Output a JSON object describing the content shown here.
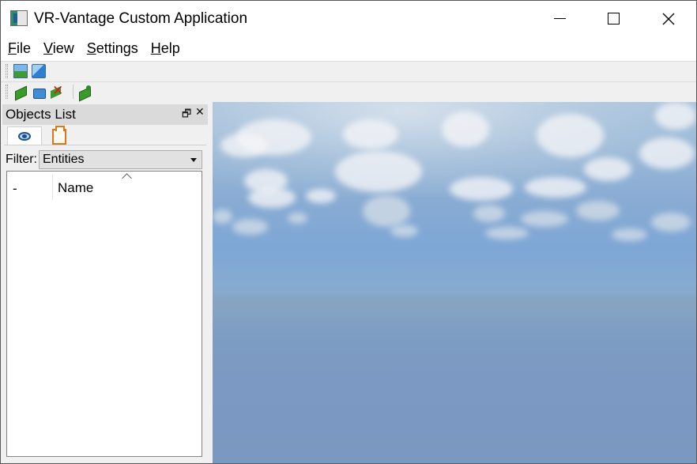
{
  "window": {
    "title": "VR-Vantage Custom Application",
    "icon": "app-icon",
    "controls": [
      "minimize-icon",
      "maximize-icon",
      "close-icon"
    ]
  },
  "menubar": {
    "file": {
      "label_underline": "F",
      "label_rest": "ile"
    },
    "view": {
      "label_underline": "V",
      "label_rest": "iew"
    },
    "settings": {
      "label_underline": "S",
      "label_rest": "ettings"
    },
    "help": {
      "label_underline": "H",
      "label_rest": "elp"
    }
  },
  "toolbar1": {
    "icons": [
      "picture-icon",
      "picture-blue-icon"
    ]
  },
  "toolbar2": {
    "icons": [
      "green-object-icon",
      "blue-object-icon",
      "delete-object-icon",
      "export-object-icon"
    ]
  },
  "objects_panel": {
    "title": "Objects List",
    "float_glyph": "🗗",
    "close_glyph": "✕",
    "tabs": [
      {
        "icon": "eye-icon",
        "active": true
      },
      {
        "icon": "folder-icon",
        "active": false
      }
    ],
    "filter": {
      "label": "Filter:",
      "value": "Entities"
    },
    "list": {
      "columns": [
        "-",
        "Name"
      ],
      "rows": []
    }
  },
  "viewport": {
    "scene": "sky-with-clouds-over-ocean",
    "colors": {
      "sky_top": "#a9c3dd",
      "sky_mid": "#7ea7d6",
      "sea": "#7a98c0"
    }
  }
}
